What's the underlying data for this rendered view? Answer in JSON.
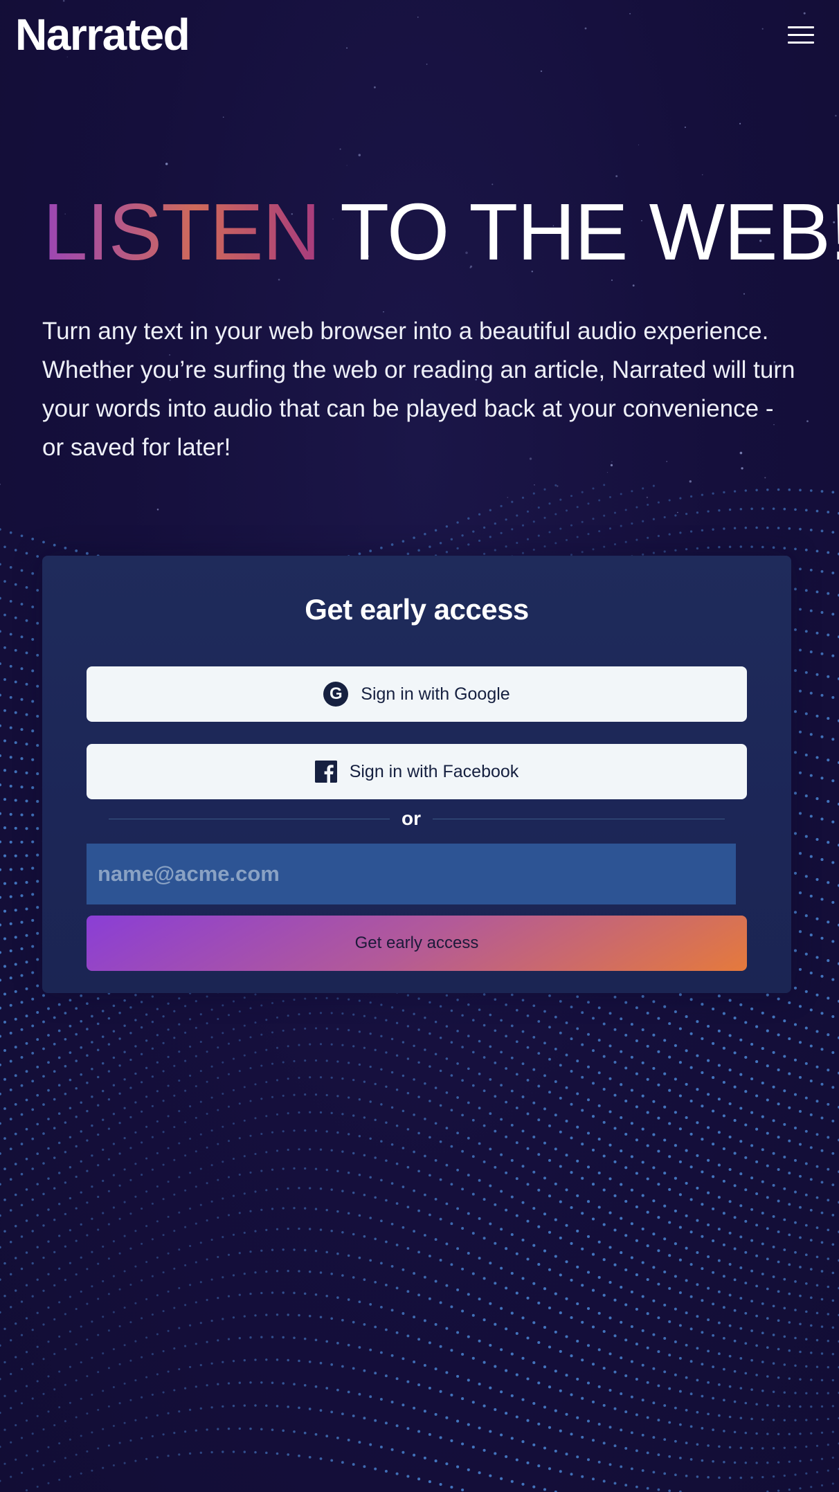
{
  "header": {
    "logo": "Narrated",
    "menu_icon": "hamburger-menu-icon"
  },
  "hero": {
    "title_accent": "LISTEN",
    "title_rest": "TO THE WEB!",
    "description": "Turn any text in your web browser into a beautiful audio experience. Whether you’re surfing the web or reading an article, Narrated will turn your words into audio that can be played back at your convenience - or saved for later!"
  },
  "signup": {
    "title": "Get early access",
    "google_label": "Sign in with Google",
    "google_icon": "google-icon",
    "facebook_label": "Sign in with Facebook",
    "facebook_icon": "facebook-icon",
    "divider_text": "or",
    "email_placeholder": "name@acme.com",
    "email_value": "",
    "submit_label": "Get early access"
  },
  "colors": {
    "background": "#140f3a",
    "card": "#1d2857",
    "input": "#2d5494",
    "social_button": "#f2f6f9",
    "accent_gradient_start": "#8a3ed6",
    "accent_gradient_end": "#e57a3c",
    "particle_wave": "#4f8fe0"
  }
}
